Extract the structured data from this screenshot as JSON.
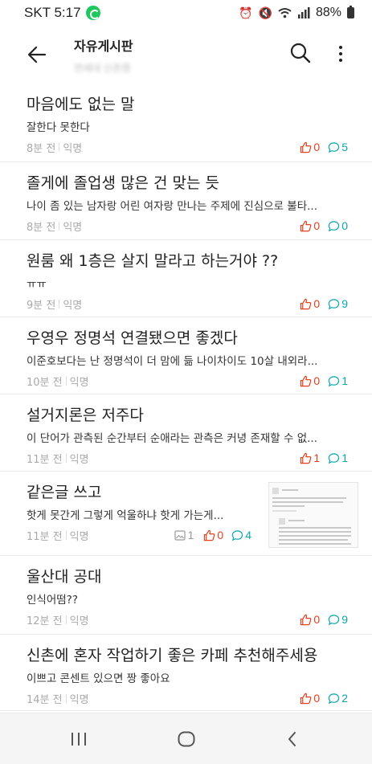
{
  "status_bar": {
    "carrier_time": "SKT 5:17",
    "battery": "88%"
  },
  "header": {
    "title": "자유게시판",
    "subtitle": "연세대 신촌캠"
  },
  "posts": [
    {
      "title": "마음에도 없는 말",
      "preview": "잘한다 못한다",
      "time": "8분 전",
      "author": "익명",
      "likes": "0",
      "comments": "5"
    },
    {
      "title": "졸게에 졸업생 많은 건 맞는 듯",
      "preview": "나이 좀 있는 남자랑 어린 여자랑 만나는 주제에 진심으로 불타...",
      "time": "8분 전",
      "author": "익명",
      "likes": "0",
      "comments": "0"
    },
    {
      "title": "원룸 왜 1층은 살지 말라고 하는거야 ??",
      "preview": "ㅠㅠ",
      "time": "9분 전",
      "author": "익명",
      "likes": "0",
      "comments": "9"
    },
    {
      "title": "우영우 정명석 연결됐으면 좋겠다",
      "preview": "이준호보다는 난 정명석이 더 맘에 듦 나이차이도 10살 내외라...",
      "time": "10분 전",
      "author": "익명",
      "likes": "0",
      "comments": "1"
    },
    {
      "title": "설거지론은 저주다",
      "preview": "이 단어가 관측된 순간부터 순애라는 관측은 커녕 존재할 수 없...",
      "time": "11분 전",
      "author": "익명",
      "likes": "1",
      "comments": "1"
    },
    {
      "title": "같은글 쓰고",
      "preview": "핫게 못간게 그렇게 억울하냐  핫게 가는게...",
      "time": "11분 전",
      "author": "익명",
      "images": "1",
      "likes": "0",
      "comments": "4"
    },
    {
      "title": "울산대 공대",
      "preview": "인식어떰??",
      "time": "12분 전",
      "author": "익명",
      "likes": "0",
      "comments": "9"
    },
    {
      "title": "신촌에 혼자 작업하기 좋은 카페 추천해주세용",
      "preview": "이쁘고 콘센트 있으면 짱 좋아요",
      "time": "14분 전",
      "author": "익명",
      "likes": "0",
      "comments": "2"
    }
  ],
  "colors": {
    "like": "#e3401f",
    "comment": "#0ca5b0",
    "meta": "#a9a9a9"
  }
}
